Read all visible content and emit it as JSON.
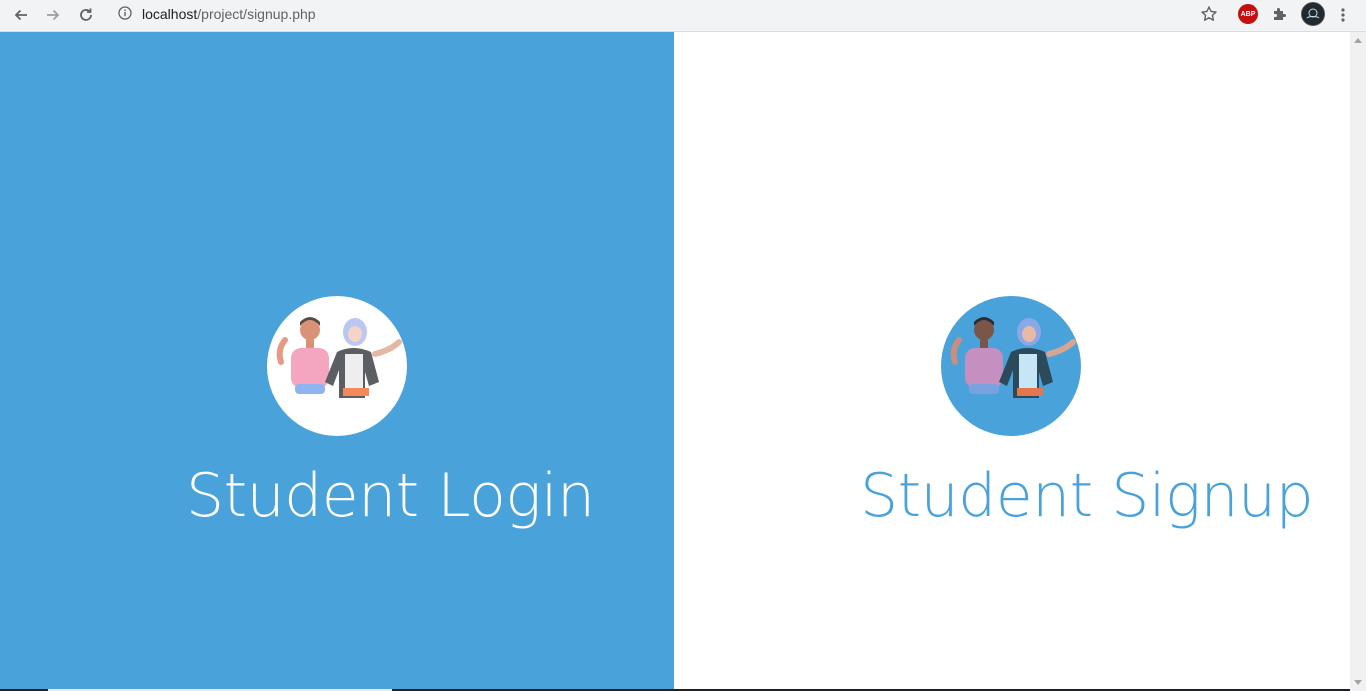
{
  "browser": {
    "url_host": "localhost",
    "url_path": "/project/signup.php",
    "extensions": [
      {
        "name": "adblock-plus",
        "label": "ABP"
      }
    ]
  },
  "main": {
    "login_card": {
      "title": "Student Login"
    },
    "signup_card": {
      "title": "Student Signup"
    }
  },
  "colors": {
    "accent": "#4aa2da",
    "background": "#ffffff"
  }
}
